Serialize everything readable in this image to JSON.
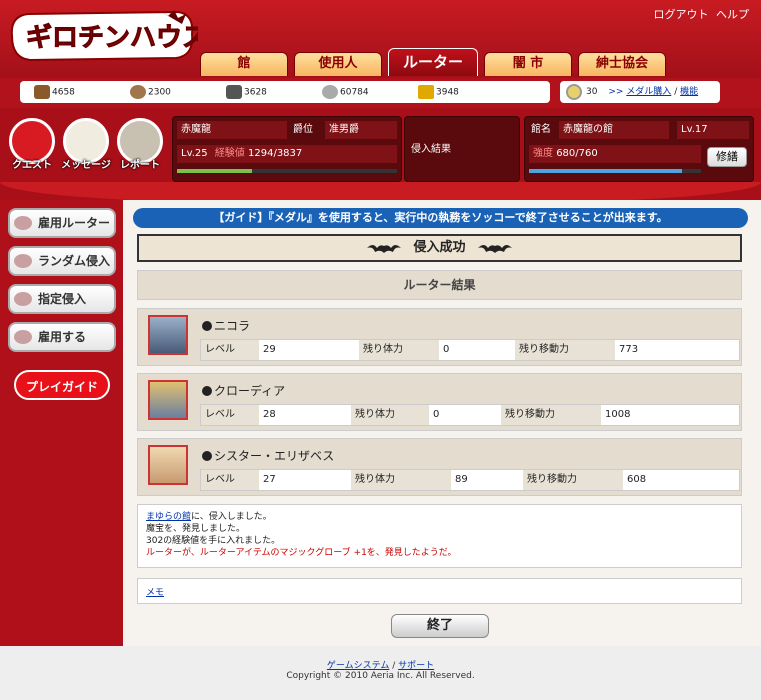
{
  "header": {
    "logo_text": "ギロチンハウス",
    "links": [
      "ログアウト",
      "ヘルプ"
    ],
    "tabs": [
      {
        "label": "館"
      },
      {
        "label": "使用人"
      },
      {
        "label": "ルーター"
      },
      {
        "label": "闇 市"
      },
      {
        "label": "紳士協会"
      }
    ]
  },
  "resources": [
    {
      "icon": "wood-icon",
      "value": "4658"
    },
    {
      "icon": "stone-icon",
      "value": "2300"
    },
    {
      "icon": "iron-icon",
      "value": "3628"
    },
    {
      "icon": "coin-icon",
      "value": "60784"
    },
    {
      "icon": "treasure-icon",
      "value": "3948"
    }
  ],
  "medal": {
    "count": "30",
    "buy_prefix": ">>",
    "buy_label": "メダル購入",
    "sep": "/",
    "function_label": "機能"
  },
  "icons": [
    {
      "label": "クエスト"
    },
    {
      "label": "メッセージ"
    },
    {
      "label": "レポート"
    }
  ],
  "player": {
    "name": "赤魔龍",
    "rank_label": "爵位",
    "rank": "准男爵",
    "level_exp": "Lv.25",
    "exp_label": "経験値",
    "exp": "1294/3837",
    "exp_fraction": 0.34
  },
  "raid_result_label": "侵入結果",
  "mansion": {
    "name_label": "館名",
    "name": "赤魔龍の館",
    "level": "Lv.17",
    "strength_label": "強度",
    "strength": "680/760",
    "strength_fraction": 0.89,
    "repair_label": "修繕"
  },
  "sidebar": {
    "items": [
      {
        "label": "雇用ルーター"
      },
      {
        "label": "ランダム侵入"
      },
      {
        "label": "指定侵入"
      },
      {
        "label": "雇用する"
      }
    ],
    "playguide": "プレイガイド"
  },
  "main": {
    "guide": "【ガイド】『メダル』を使用すると、実行中の執務をソッコーで終了させることが出来ます。",
    "success": "侵入成功",
    "result_title": "ルーター結果",
    "members": [
      {
        "name": "ニコラ",
        "level_label": "レベル",
        "level": "29",
        "hp_label": "残り体力",
        "hp": "0",
        "move_label": "残り移動力",
        "move": "773"
      },
      {
        "name": "クローディア",
        "level_label": "レベル",
        "level": "28",
        "hp_label": "残り体力",
        "hp": "0",
        "move_label": "残り移動力",
        "move": "1008"
      },
      {
        "name": "シスター・エリザベス",
        "level_label": "レベル",
        "level": "27",
        "hp_label": "残り体力",
        "hp": "89",
        "move_label": "残り移動力",
        "move": "608"
      }
    ],
    "log": {
      "target_link": "まゆらの館",
      "line1_rest": "に、侵入しました。",
      "line2": "魔宝を、発見しました。",
      "line3": "302の経験値を手に入れました。",
      "line4": "ルーターが、ルーターアイテムのマジックグローブ +1を、発見したようだ。"
    },
    "memo_label": "メモ",
    "end_label": "終了"
  },
  "footer": {
    "game_system": "ゲームシステム",
    "sep": "/",
    "support": "サポート",
    "copyright": "Copyright © 2010 Aeria Inc. All Reserved."
  },
  "colors": {
    "header_red": "#c81b22",
    "panel_dark": "#5a0a0c",
    "guide_blue": "#1a62b6",
    "link_blue": "#0033aa",
    "exp_green": "#7cc24a",
    "strength_blue": "#4fa3e0"
  }
}
